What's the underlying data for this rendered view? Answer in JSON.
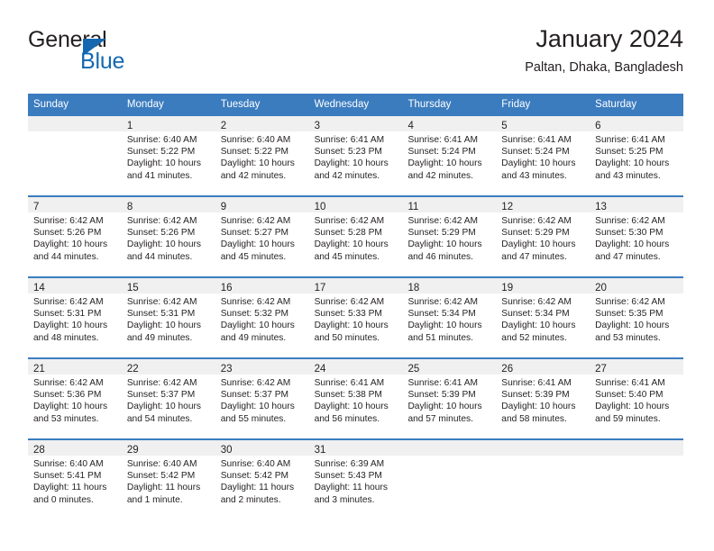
{
  "brand": {
    "name_part1": "General",
    "name_part2": "Blue",
    "triangle_icon": "triangle-icon",
    "accent_color": "#1468b0"
  },
  "header": {
    "title": "January 2024",
    "subtitle": "Paltan, Dhaka, Bangladesh"
  },
  "calendar": {
    "header_color": "#3b7cbf",
    "daynum_bg": "#f0f0f0",
    "weekdays": [
      "Sunday",
      "Monday",
      "Tuesday",
      "Wednesday",
      "Thursday",
      "Friday",
      "Saturday"
    ],
    "weeks": [
      [
        {
          "day": "",
          "sunrise": "",
          "sunset": "",
          "daylight": ""
        },
        {
          "day": "1",
          "sunrise": "Sunrise: 6:40 AM",
          "sunset": "Sunset: 5:22 PM",
          "daylight": "Daylight: 10 hours and 41 minutes."
        },
        {
          "day": "2",
          "sunrise": "Sunrise: 6:40 AM",
          "sunset": "Sunset: 5:22 PM",
          "daylight": "Daylight: 10 hours and 42 minutes."
        },
        {
          "day": "3",
          "sunrise": "Sunrise: 6:41 AM",
          "sunset": "Sunset: 5:23 PM",
          "daylight": "Daylight: 10 hours and 42 minutes."
        },
        {
          "day": "4",
          "sunrise": "Sunrise: 6:41 AM",
          "sunset": "Sunset: 5:24 PM",
          "daylight": "Daylight: 10 hours and 42 minutes."
        },
        {
          "day": "5",
          "sunrise": "Sunrise: 6:41 AM",
          "sunset": "Sunset: 5:24 PM",
          "daylight": "Daylight: 10 hours and 43 minutes."
        },
        {
          "day": "6",
          "sunrise": "Sunrise: 6:41 AM",
          "sunset": "Sunset: 5:25 PM",
          "daylight": "Daylight: 10 hours and 43 minutes."
        }
      ],
      [
        {
          "day": "7",
          "sunrise": "Sunrise: 6:42 AM",
          "sunset": "Sunset: 5:26 PM",
          "daylight": "Daylight: 10 hours and 44 minutes."
        },
        {
          "day": "8",
          "sunrise": "Sunrise: 6:42 AM",
          "sunset": "Sunset: 5:26 PM",
          "daylight": "Daylight: 10 hours and 44 minutes."
        },
        {
          "day": "9",
          "sunrise": "Sunrise: 6:42 AM",
          "sunset": "Sunset: 5:27 PM",
          "daylight": "Daylight: 10 hours and 45 minutes."
        },
        {
          "day": "10",
          "sunrise": "Sunrise: 6:42 AM",
          "sunset": "Sunset: 5:28 PM",
          "daylight": "Daylight: 10 hours and 45 minutes."
        },
        {
          "day": "11",
          "sunrise": "Sunrise: 6:42 AM",
          "sunset": "Sunset: 5:29 PM",
          "daylight": "Daylight: 10 hours and 46 minutes."
        },
        {
          "day": "12",
          "sunrise": "Sunrise: 6:42 AM",
          "sunset": "Sunset: 5:29 PM",
          "daylight": "Daylight: 10 hours and 47 minutes."
        },
        {
          "day": "13",
          "sunrise": "Sunrise: 6:42 AM",
          "sunset": "Sunset: 5:30 PM",
          "daylight": "Daylight: 10 hours and 47 minutes."
        }
      ],
      [
        {
          "day": "14",
          "sunrise": "Sunrise: 6:42 AM",
          "sunset": "Sunset: 5:31 PM",
          "daylight": "Daylight: 10 hours and 48 minutes."
        },
        {
          "day": "15",
          "sunrise": "Sunrise: 6:42 AM",
          "sunset": "Sunset: 5:31 PM",
          "daylight": "Daylight: 10 hours and 49 minutes."
        },
        {
          "day": "16",
          "sunrise": "Sunrise: 6:42 AM",
          "sunset": "Sunset: 5:32 PM",
          "daylight": "Daylight: 10 hours and 49 minutes."
        },
        {
          "day": "17",
          "sunrise": "Sunrise: 6:42 AM",
          "sunset": "Sunset: 5:33 PM",
          "daylight": "Daylight: 10 hours and 50 minutes."
        },
        {
          "day": "18",
          "sunrise": "Sunrise: 6:42 AM",
          "sunset": "Sunset: 5:34 PM",
          "daylight": "Daylight: 10 hours and 51 minutes."
        },
        {
          "day": "19",
          "sunrise": "Sunrise: 6:42 AM",
          "sunset": "Sunset: 5:34 PM",
          "daylight": "Daylight: 10 hours and 52 minutes."
        },
        {
          "day": "20",
          "sunrise": "Sunrise: 6:42 AM",
          "sunset": "Sunset: 5:35 PM",
          "daylight": "Daylight: 10 hours and 53 minutes."
        }
      ],
      [
        {
          "day": "21",
          "sunrise": "Sunrise: 6:42 AM",
          "sunset": "Sunset: 5:36 PM",
          "daylight": "Daylight: 10 hours and 53 minutes."
        },
        {
          "day": "22",
          "sunrise": "Sunrise: 6:42 AM",
          "sunset": "Sunset: 5:37 PM",
          "daylight": "Daylight: 10 hours and 54 minutes."
        },
        {
          "day": "23",
          "sunrise": "Sunrise: 6:42 AM",
          "sunset": "Sunset: 5:37 PM",
          "daylight": "Daylight: 10 hours and 55 minutes."
        },
        {
          "day": "24",
          "sunrise": "Sunrise: 6:41 AM",
          "sunset": "Sunset: 5:38 PM",
          "daylight": "Daylight: 10 hours and 56 minutes."
        },
        {
          "day": "25",
          "sunrise": "Sunrise: 6:41 AM",
          "sunset": "Sunset: 5:39 PM",
          "daylight": "Daylight: 10 hours and 57 minutes."
        },
        {
          "day": "26",
          "sunrise": "Sunrise: 6:41 AM",
          "sunset": "Sunset: 5:39 PM",
          "daylight": "Daylight: 10 hours and 58 minutes."
        },
        {
          "day": "27",
          "sunrise": "Sunrise: 6:41 AM",
          "sunset": "Sunset: 5:40 PM",
          "daylight": "Daylight: 10 hours and 59 minutes."
        }
      ],
      [
        {
          "day": "28",
          "sunrise": "Sunrise: 6:40 AM",
          "sunset": "Sunset: 5:41 PM",
          "daylight": "Daylight: 11 hours and 0 minutes."
        },
        {
          "day": "29",
          "sunrise": "Sunrise: 6:40 AM",
          "sunset": "Sunset: 5:42 PM",
          "daylight": "Daylight: 11 hours and 1 minute."
        },
        {
          "day": "30",
          "sunrise": "Sunrise: 6:40 AM",
          "sunset": "Sunset: 5:42 PM",
          "daylight": "Daylight: 11 hours and 2 minutes."
        },
        {
          "day": "31",
          "sunrise": "Sunrise: 6:39 AM",
          "sunset": "Sunset: 5:43 PM",
          "daylight": "Daylight: 11 hours and 3 minutes."
        },
        {
          "day": "",
          "sunrise": "",
          "sunset": "",
          "daylight": ""
        },
        {
          "day": "",
          "sunrise": "",
          "sunset": "",
          "daylight": ""
        },
        {
          "day": "",
          "sunrise": "",
          "sunset": "",
          "daylight": ""
        }
      ]
    ]
  }
}
